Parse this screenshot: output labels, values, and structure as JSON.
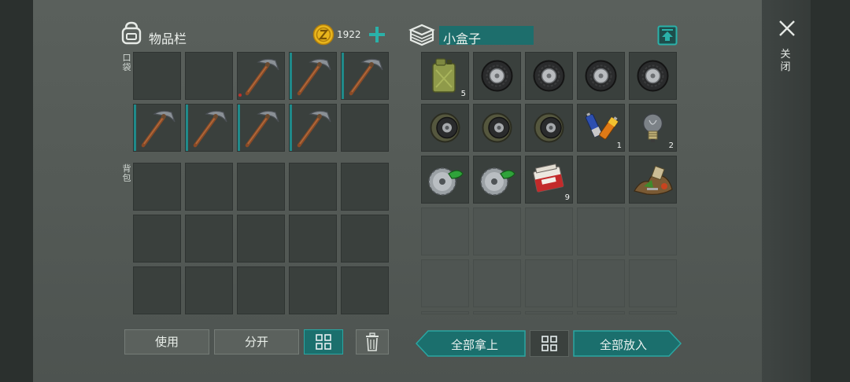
{
  "inventory": {
    "title": "物品栏",
    "coin_count": "1922",
    "pocket_label": "口袋",
    "backpack_label": "背包",
    "pocket_slots": [
      {
        "item": "",
        "count": ""
      },
      {
        "item": "",
        "count": ""
      },
      {
        "item": "pickaxe",
        "count": "",
        "marker": "red"
      },
      {
        "item": "pickaxe",
        "count": "",
        "marker": "teal"
      },
      {
        "item": "pickaxe",
        "count": "",
        "marker": "teal"
      },
      {
        "item": "pickaxe",
        "count": "",
        "marker": "teal"
      },
      {
        "item": "pickaxe",
        "count": "",
        "marker": "teal"
      },
      {
        "item": "pickaxe",
        "count": "",
        "marker": "teal"
      },
      {
        "item": "pickaxe",
        "count": "",
        "marker": "teal"
      },
      {
        "item": "",
        "count": ""
      }
    ],
    "backpack_slot_count": 15
  },
  "container": {
    "name": "小盒子",
    "slots": [
      {
        "item": "gas-canister",
        "count": "5"
      },
      {
        "item": "tire",
        "count": ""
      },
      {
        "item": "tire",
        "count": ""
      },
      {
        "item": "tire",
        "count": ""
      },
      {
        "item": "tire",
        "count": ""
      },
      {
        "item": "wheel",
        "count": ""
      },
      {
        "item": "wheel",
        "count": ""
      },
      {
        "item": "wheel",
        "count": ""
      },
      {
        "item": "batteries",
        "count": "1"
      },
      {
        "item": "light-bulb",
        "count": "2"
      },
      {
        "item": "saw-blade",
        "count": ""
      },
      {
        "item": "saw-blade",
        "count": ""
      },
      {
        "item": "cigarette-pack",
        "count": "9"
      },
      {
        "item": "",
        "count": ""
      },
      {
        "item": "scrap-pile",
        "count": ""
      }
    ],
    "empty_rows": 3
  },
  "buttons": {
    "use": "使用",
    "split": "分开",
    "take_all": "全部拿上",
    "put_all": "全部放入"
  },
  "close_label": "关闭",
  "colors": {
    "accent": "#1b6f6d",
    "accent_border": "#2aa6a2",
    "coin": "#e8b51c"
  }
}
